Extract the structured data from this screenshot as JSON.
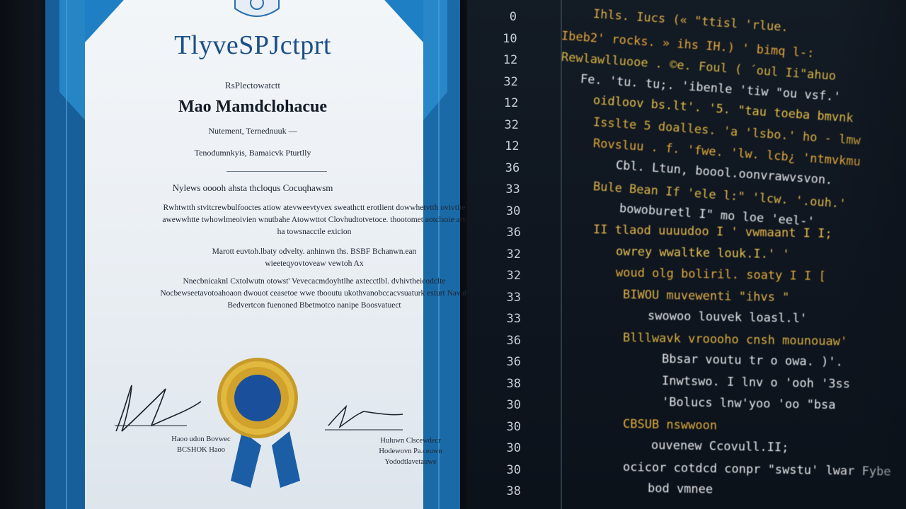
{
  "certificate": {
    "title": "TlyveSPJctprt",
    "label": "RsPlectowatctt",
    "name": "Mao Mamdclohacue",
    "line1": "Nutement, Ternednuuk —",
    "line2": "Tenodumnkyis, Bamaicvk Pturtlly",
    "heading": "Nylews ooooh ahsta thcloqus Cocuqhawsm",
    "paragraph1": "Rwhtwtth stvitcrewbulfooctes atiow atevweevtyvex sweathctt erotlient dowwhetvtth ovivtite awewwhtte twhowlmeoivien wnutbahe Atowwttot Clovhudtotvetoce. thootomet aotclsoie atv ha towsnacctle exicion",
    "paragraph2": "Marott euvtoh.lbaty odvelty. anhinwn ths. BSBF Bchanwn.ean wieeteqyovtoveaw vewtoh Ax",
    "paragraph3": "Nnecbnicaknl Cxtolwutn otowst' Vevecacmdoyhtlhe axtecctlbl. dvhivtheicodclte Nocbewseetavotoahoaon dwouot ceasetoe wwe tbooutu ukothvanobccacvsuaturk esturt Navah Bedvertcon fuenoned Bbetmotco nanipe Boosvatuect",
    "signature_left": [
      "Haoo udon Bovwec",
      "BCSHOK Haoo"
    ],
    "signature_right": [
      "Huluwn Clscewdecr",
      "Hodewovn Pa.ceuwn",
      "Yododtlavetauwe"
    ]
  },
  "editor": {
    "line_numbers": [
      "0",
      "10",
      "12",
      "32",
      "12",
      "32",
      "12",
      "36",
      "33",
      "30",
      "36",
      "32",
      "32",
      "33",
      "33",
      "36",
      "36",
      "38",
      "30",
      "30",
      "30",
      "30",
      "38"
    ],
    "code_lines": [
      {
        "text": "Ihls. Iucs (« \"ttisl 'rlue.",
        "color": "#e0b049"
      },
      {
        "text": "Ibeb2' rocks. » ihs IH.) ' bimq l-:",
        "color": "#e8a73c"
      },
      {
        "text": "Rewlawlluooe . ©e. Foul ( ´oul Ii\"ahuo",
        "color": "#d9b545"
      },
      {
        "text": "  Fe. 'tu. tu;. 'ibenle 'tiw \"ou vsf.'",
        "color": "#e5e8ec"
      },
      {
        "text": "  oidloov bs.lt'. '5. \"tau toeba bmvnk",
        "color": "#e7c04a"
      },
      {
        "text": "   Isslte 5 doalles. 'a 'lsbo.' ho - lmw",
        "color": "#dcb13f"
      },
      {
        "text": "Rovsluu . f. 'fwe. 'lw. lcb¿ 'ntmvkmu",
        "color": "#e3a93a"
      },
      {
        "text": "     Cbl. Ltun, boool.oonvrawvsvon.",
        "color": "#e6e9ec"
      },
      {
        "text": "  Bule Bean If 'ele l:\" 'lcw.  '.ouh.'",
        "color": "#dfb74a"
      },
      {
        "text": "       bowoburetl I\" mo loe 'eel-'",
        "color": "#e5e8ec"
      },
      {
        "text": "  II tlaod  uuuudoo  I ' vwmaant I I;",
        "color": "#e8b84a"
      },
      {
        "text": "        owrey  wwaltke  louk.I.' '",
        "color": "#e8c451"
      },
      {
        "text": "       woud  olg  boliril.  soaty I I [",
        "color": "#e3ac3c"
      },
      {
        "text": "       BIWOU  muvewenti \"ihvs \"",
        "color": "#e0b049"
      },
      {
        "text": "          swowoo  louvek  loasl.l'",
        "color": "#e5e8ec"
      },
      {
        "text": "       Blllwavk  vroooho   cnsh  mounouaw'",
        "color": "#dcb13f"
      },
      {
        "text": "              Bbsar  voutu  tr  o  owa. )'.",
        "color": "#e5e8ec"
      },
      {
        "text": "            Inwtswo.  I lnv  o  'ooh  '3ss",
        "color": "#e6e9ec"
      },
      {
        "text": "              'Bolucs  lnw'yoo  'oo  \"bsa",
        "color": "#e6e9ec"
      },
      {
        "text": "        CBSUB  nswwoon",
        "color": "#e3ac3c"
      },
      {
        "text": "            ouvenew  Ccovull.II;",
        "color": "#e5e8ec"
      },
      {
        "text": "        ocicor  cotdcd  conpr  \"swstu'  lwar  Fybe",
        "color": "#e6e9ec"
      },
      {
        "text": "              bod  vmnee",
        "color": "#e5e8ec"
      }
    ]
  }
}
